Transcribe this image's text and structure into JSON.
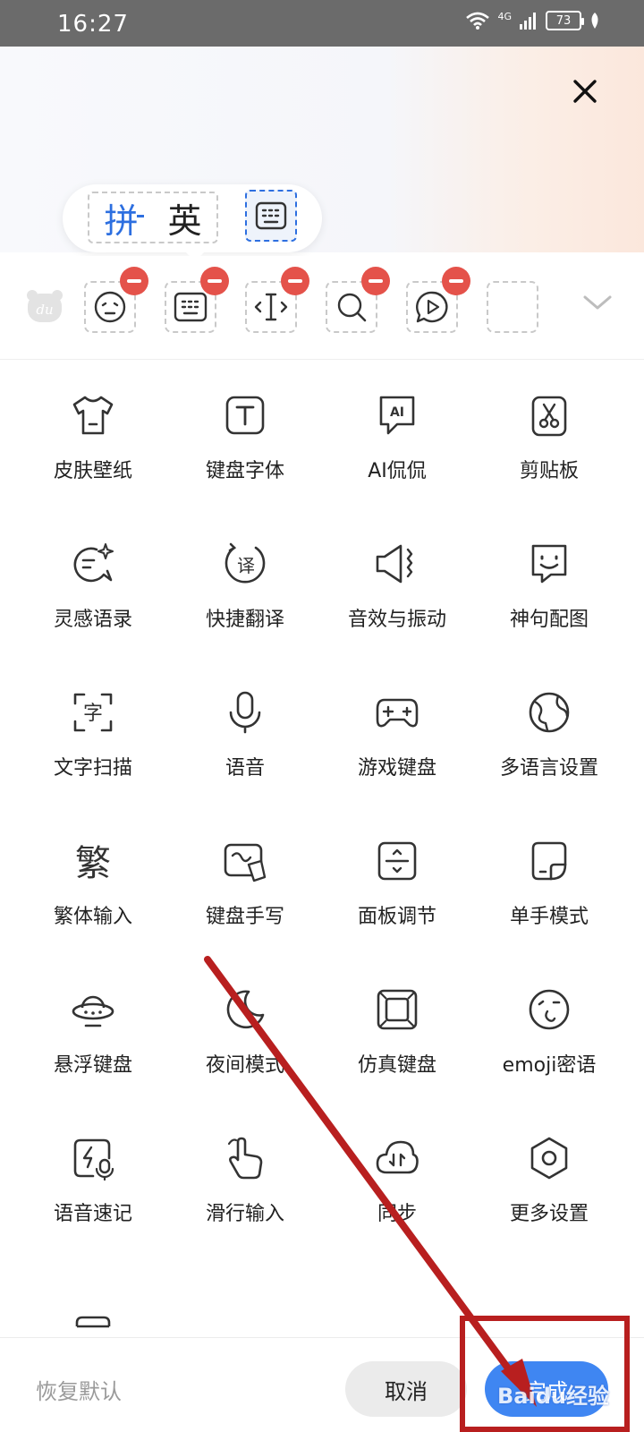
{
  "status": {
    "time": "16:27",
    "network": "4G",
    "battery": "73"
  },
  "mode": {
    "pinyin": "拼",
    "english": "英"
  },
  "grid": [
    {
      "label": "皮肤壁纸",
      "icon": "tshirt-icon"
    },
    {
      "label": "键盘字体",
      "icon": "font-t-icon"
    },
    {
      "label": "AI侃侃",
      "icon": "ai-chat-icon"
    },
    {
      "label": "剪贴板",
      "icon": "clipboard-scissors-icon"
    },
    {
      "label": "灵感语录",
      "icon": "inspiration-chat-icon"
    },
    {
      "label": "快捷翻译",
      "icon": "translate-icon"
    },
    {
      "label": "音效与振动",
      "icon": "speaker-vibration-icon"
    },
    {
      "label": "神句配图",
      "icon": "smile-bubble-icon"
    },
    {
      "label": "文字扫描",
      "icon": "scan-text-icon"
    },
    {
      "label": "语音",
      "icon": "microphone-icon"
    },
    {
      "label": "游戏键盘",
      "icon": "gamepad-icon"
    },
    {
      "label": "多语言设置",
      "icon": "globe-icon"
    },
    {
      "label": "繁体输入",
      "icon": "traditional-char-icon"
    },
    {
      "label": "键盘手写",
      "icon": "handwriting-icon"
    },
    {
      "label": "面板调节",
      "icon": "panel-adjust-icon"
    },
    {
      "label": "单手模式",
      "icon": "one-hand-icon"
    },
    {
      "label": "悬浮键盘",
      "icon": "ufo-icon"
    },
    {
      "label": "夜间模式",
      "icon": "moon-icon"
    },
    {
      "label": "仿真键盘",
      "icon": "square-key-icon"
    },
    {
      "label": "emoji密语",
      "icon": "emoji-wink-icon"
    },
    {
      "label": "语音速记",
      "icon": "voice-memo-icon"
    },
    {
      "label": "滑行输入",
      "icon": "swipe-hand-icon"
    },
    {
      "label": "同步",
      "icon": "cloud-sync-icon"
    },
    {
      "label": "更多设置",
      "icon": "settings-hex-icon"
    },
    {
      "label": "",
      "icon": "keyboard-partial-icon"
    }
  ],
  "bottom": {
    "reset": "恢复默认",
    "cancel": "取消",
    "confirm": "完成",
    "watermark": "Baidu经验"
  }
}
